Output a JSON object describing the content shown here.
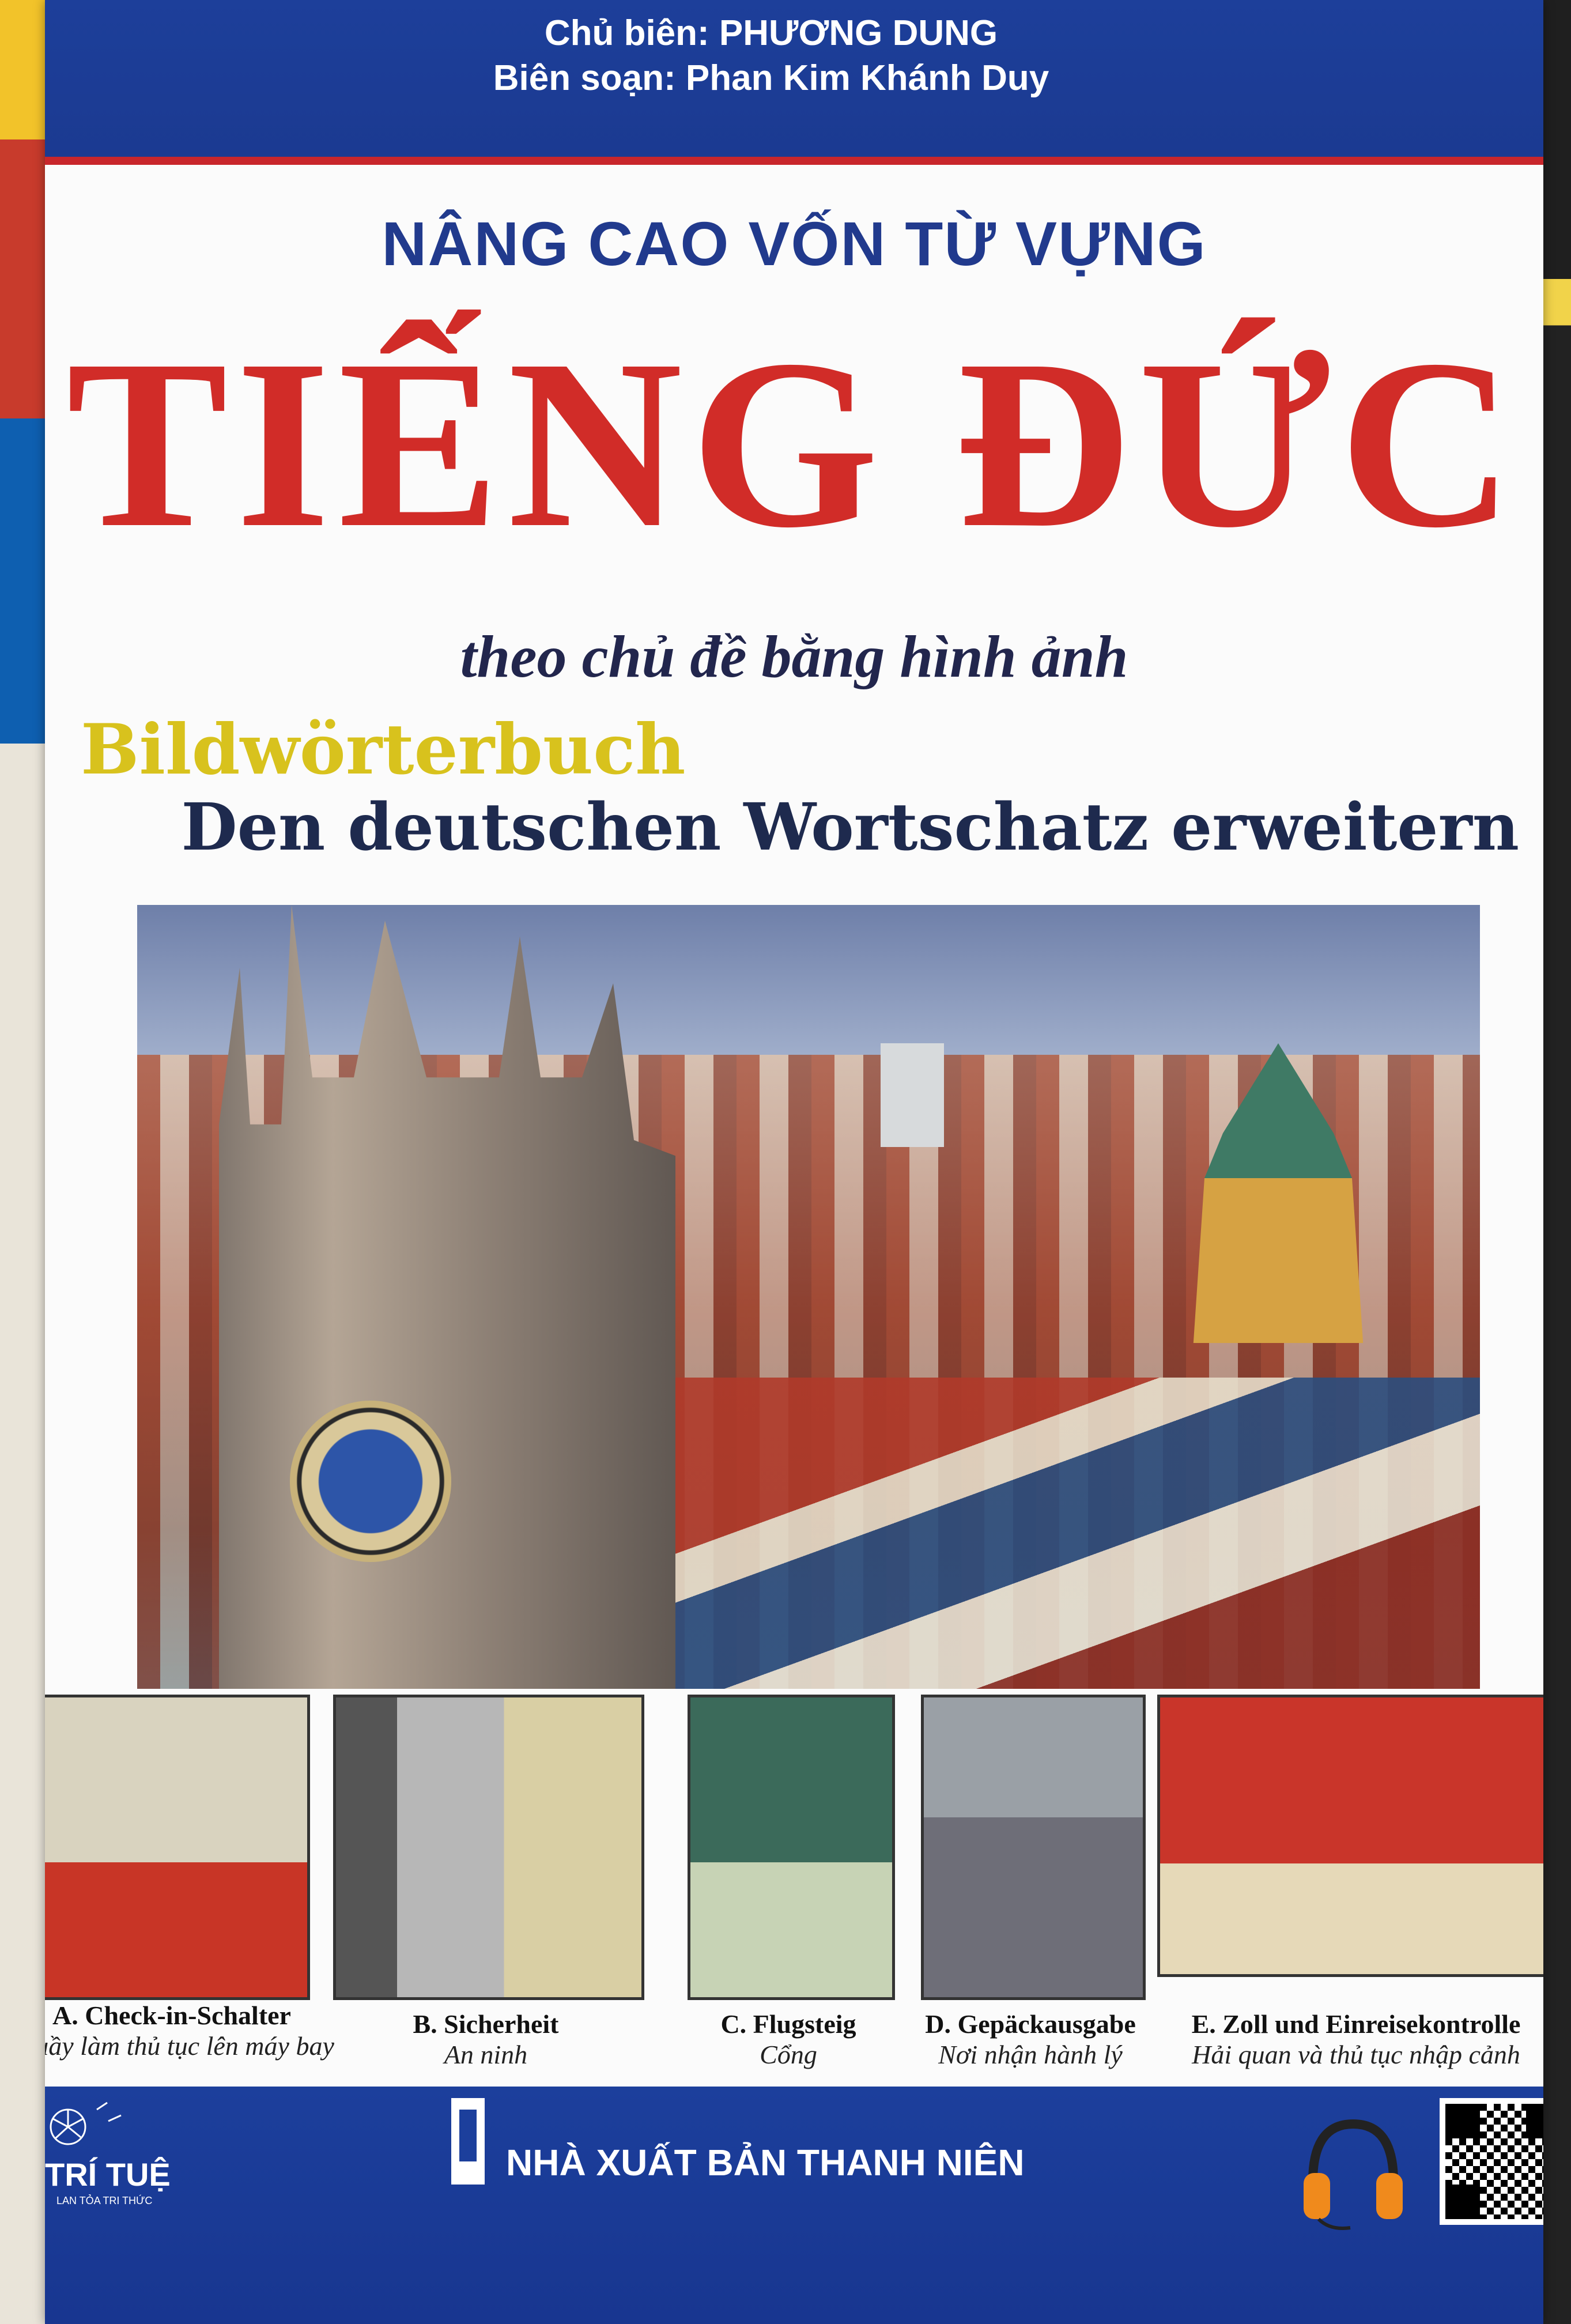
{
  "cover": {
    "chief_editor": "Chủ biên: PHƯƠNG DUNG",
    "compiler": "Biên soạn: Phan Kim Khánh Duy",
    "subtitle_vn": "NÂNG CAO VỐN TỪ VỰNG",
    "title": "TIẾNG ĐỨC",
    "tagline": "theo chủ đề bằng hình ảnh",
    "bildworterbuch": "Bildwörterbuch",
    "german_subtitle": "Den deutschen Wortschatz erweitern"
  },
  "thumbnails": [
    {
      "de": "A. Check-in-Schalter",
      "vn": "Quầy làm thủ tục lên máy bay"
    },
    {
      "de": "B. Sicherheit",
      "vn": "An ninh"
    },
    {
      "de": "C. Flugsteig",
      "vn": "Cổng"
    },
    {
      "de": "D. Gepäckausgabe",
      "vn": "Nơi nhận hành lý"
    },
    {
      "de": "E. Zoll und Einreisekontrolle",
      "vn": "Hải quan và thủ tục nhập cảnh"
    }
  ],
  "footer": {
    "brand": "TRÍ TUỆ",
    "brand_tagline": "LAN TỎA TRI THỨC",
    "publisher": "NHÀ XUẤT BẢN THANH NIÊN"
  },
  "colors": {
    "band_blue": "#1c3f9c",
    "title_red": "#d12c28",
    "heading_blue": "#213a8d",
    "bild_yellow": "#d8c21d"
  },
  "icons": [
    "headphones-icon",
    "qr-code-icon",
    "publisher-logo-icon",
    "dandelion-logo-icon"
  ]
}
